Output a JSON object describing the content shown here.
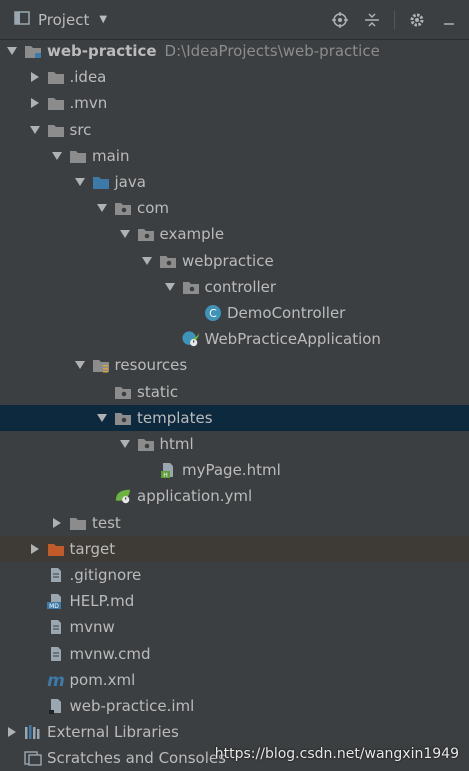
{
  "toolbar": {
    "title": "Project",
    "icons": [
      "project-icon",
      "dropdown-arrow",
      "locate-icon",
      "collapse-all-icon",
      "gear-icon",
      "hide-icon"
    ]
  },
  "tree": [
    {
      "label": "web-practice",
      "path": "D:\\IdeaProjects\\web-practice",
      "arrow": "down",
      "icon": "module-folder",
      "depth": 0,
      "bold": true
    },
    {
      "label": ".idea",
      "arrow": "right",
      "icon": "folder",
      "depth": 1
    },
    {
      "label": ".mvn",
      "arrow": "right",
      "icon": "folder",
      "depth": 1
    },
    {
      "label": "src",
      "arrow": "down",
      "icon": "folder",
      "depth": 1
    },
    {
      "label": "main",
      "arrow": "down",
      "icon": "folder",
      "depth": 2
    },
    {
      "label": "java",
      "arrow": "down",
      "icon": "source-folder",
      "depth": 3
    },
    {
      "label": "com",
      "arrow": "down",
      "icon": "package",
      "depth": 4
    },
    {
      "label": "example",
      "arrow": "down",
      "icon": "package",
      "depth": 5
    },
    {
      "label": "webpractice",
      "arrow": "down",
      "icon": "package",
      "depth": 6
    },
    {
      "label": "controller",
      "arrow": "down",
      "icon": "package",
      "depth": 7
    },
    {
      "label": "DemoController",
      "arrow": "none",
      "icon": "java-class",
      "depth": 8
    },
    {
      "label": "WebPracticeApplication",
      "arrow": "none",
      "icon": "spring-boot-class",
      "depth": 7
    },
    {
      "label": "resources",
      "arrow": "down",
      "icon": "resources-folder",
      "depth": 3
    },
    {
      "label": "static",
      "arrow": "none",
      "icon": "package",
      "depth": 4
    },
    {
      "label": "templates",
      "arrow": "down",
      "icon": "package",
      "depth": 4,
      "selected": true
    },
    {
      "label": "html",
      "arrow": "down",
      "icon": "package",
      "depth": 5
    },
    {
      "label": "myPage.html",
      "arrow": "none",
      "icon": "html-file",
      "depth": 6
    },
    {
      "label": "application.yml",
      "arrow": "none",
      "icon": "spring-yml",
      "depth": 4
    },
    {
      "label": "test",
      "arrow": "right",
      "icon": "folder",
      "depth": 2
    },
    {
      "label": "target",
      "arrow": "right",
      "icon": "excluded-folder",
      "depth": 1,
      "excluded": true
    },
    {
      "label": ".gitignore",
      "arrow": "none",
      "icon": "text-file",
      "depth": 1
    },
    {
      "label": "HELP.md",
      "arrow": "none",
      "icon": "md-file",
      "depth": 1
    },
    {
      "label": "mvnw",
      "arrow": "none",
      "icon": "text-file",
      "depth": 1
    },
    {
      "label": "mvnw.cmd",
      "arrow": "none",
      "icon": "text-file",
      "depth": 1
    },
    {
      "label": "pom.xml",
      "arrow": "none",
      "icon": "maven-file",
      "depth": 1
    },
    {
      "label": "web-practice.iml",
      "arrow": "none",
      "icon": "iml-file",
      "depth": 1
    },
    {
      "label": "External Libraries",
      "arrow": "right",
      "icon": "libraries",
      "depth": 0
    },
    {
      "label": "Scratches and Consoles",
      "arrow": "none",
      "icon": "scratches",
      "depth": 0
    }
  ],
  "colors": {
    "folder": "#8c8c8c",
    "source_folder": "#3d7aa8",
    "excluded_folder": "#c35a2a",
    "selection": "#0d293e",
    "class": "#3f93b9",
    "spring": "#6db33f"
  },
  "watermark": "https://blog.csdn.net/wangxin1949"
}
